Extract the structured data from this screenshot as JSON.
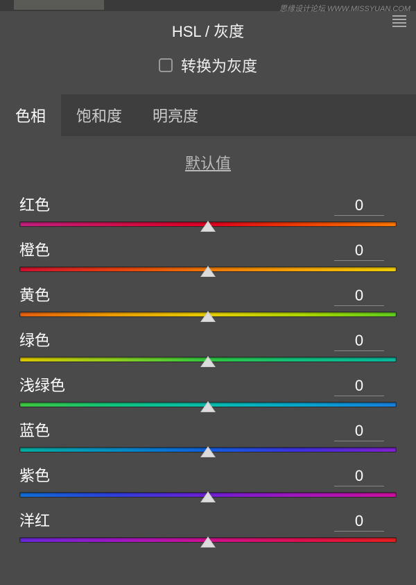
{
  "watermark": "思缘设计论坛 WWW.MISSYUAN.COM",
  "panelTitle": "HSL / 灰度",
  "convertLabel": "转换为灰度",
  "tabs": {
    "hue": "色相",
    "saturation": "饱和度",
    "luminance": "明亮度"
  },
  "defaultLabel": "默认值",
  "sliders": [
    {
      "name": "red",
      "label": "红色",
      "value": "0",
      "gradientClass": "g-red"
    },
    {
      "name": "orange",
      "label": "橙色",
      "value": "0",
      "gradientClass": "g-orange"
    },
    {
      "name": "yellow",
      "label": "黄色",
      "value": "0",
      "gradientClass": "g-yellow"
    },
    {
      "name": "green",
      "label": "绿色",
      "value": "0",
      "gradientClass": "g-green"
    },
    {
      "name": "aqua",
      "label": "浅绿色",
      "value": "0",
      "gradientClass": "g-aqua"
    },
    {
      "name": "blue",
      "label": "蓝色",
      "value": "0",
      "gradientClass": "g-blue"
    },
    {
      "name": "purple",
      "label": "紫色",
      "value": "0",
      "gradientClass": "g-purple"
    },
    {
      "name": "magenta",
      "label": "洋红",
      "value": "0",
      "gradientClass": "g-magenta"
    }
  ]
}
